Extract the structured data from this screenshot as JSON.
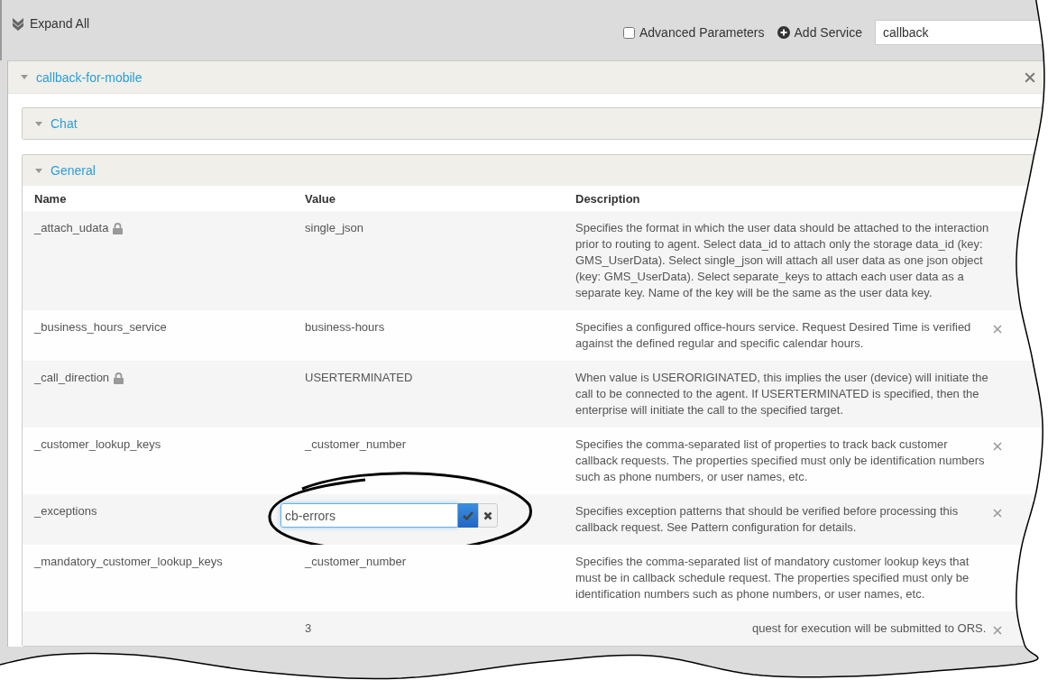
{
  "toolbar": {
    "expand_all": "Expand All",
    "advanced_parameters": {
      "label": "Advanced Parameters",
      "checked": false
    },
    "add_service": "Add Service",
    "search": {
      "value": "callback"
    }
  },
  "services": [
    {
      "name": "callback-for-mobile",
      "expanded": true,
      "groups": [
        {
          "name": "Chat",
          "expanded": false
        },
        {
          "name": "General",
          "expanded": true,
          "columns": [
            "Name",
            "Value",
            "Description"
          ],
          "rows": [
            {
              "name": "_attach_udata",
              "locked": true,
              "value": "single_json",
              "description": "Specifies the format in which the user data should be attached to the interaction prior to routing to agent. Select data_id to attach only the storage data_id (key: GMS_UserData). Select single_json will attach all user data as one json object (key: GMS_UserData). Select separate_keys to attach each user data as a separate key. Name of the key will be the same as the user data key.",
              "removable": false,
              "editing": false
            },
            {
              "name": "_business_hours_service",
              "locked": false,
              "value": "business-hours",
              "description": "Specifies a configured office-hours service. Request Desired Time is verified against the defined regular and specific calendar hours.",
              "removable": true,
              "editing": false
            },
            {
              "name": "_call_direction",
              "locked": true,
              "value": "USERTERMINATED",
              "description": "When value is USERORIGINATED, this implies the user (device) will initiate the call to be connected to the agent. If USERTERMINATED is specified, then the enterprise will initiate the call to the specified target.",
              "removable": false,
              "editing": false
            },
            {
              "name": "_customer_lookup_keys",
              "locked": false,
              "value": "_customer_number",
              "description": "Specifies the comma-separated list of properties to track back customer callback requests. The properties specified must only be identification numbers such as phone numbers, or user names, etc.",
              "removable": true,
              "editing": false
            },
            {
              "name": "_exceptions",
              "locked": false,
              "value": "cb-errors",
              "description": "Specifies exception patterns that should be verified before processing this callback request. See Pattern configuration for details.",
              "removable": true,
              "editing": true
            },
            {
              "name": "_mandatory_customer_lookup_keys",
              "locked": false,
              "value": "_customer_number",
              "description": "Specifies the comma-separated list of mandatory customer lookup keys that must be in callback schedule request. The properties specified must only be identification numbers such as phone numbers, or user names, etc.",
              "removable": false,
              "editing": false
            },
            {
              "locked": false,
              "value": "3",
              "description": "quest for execution will be submitted to ORS.",
              "removable": true,
              "editing": false
            }
          ]
        }
      ]
    }
  ]
}
